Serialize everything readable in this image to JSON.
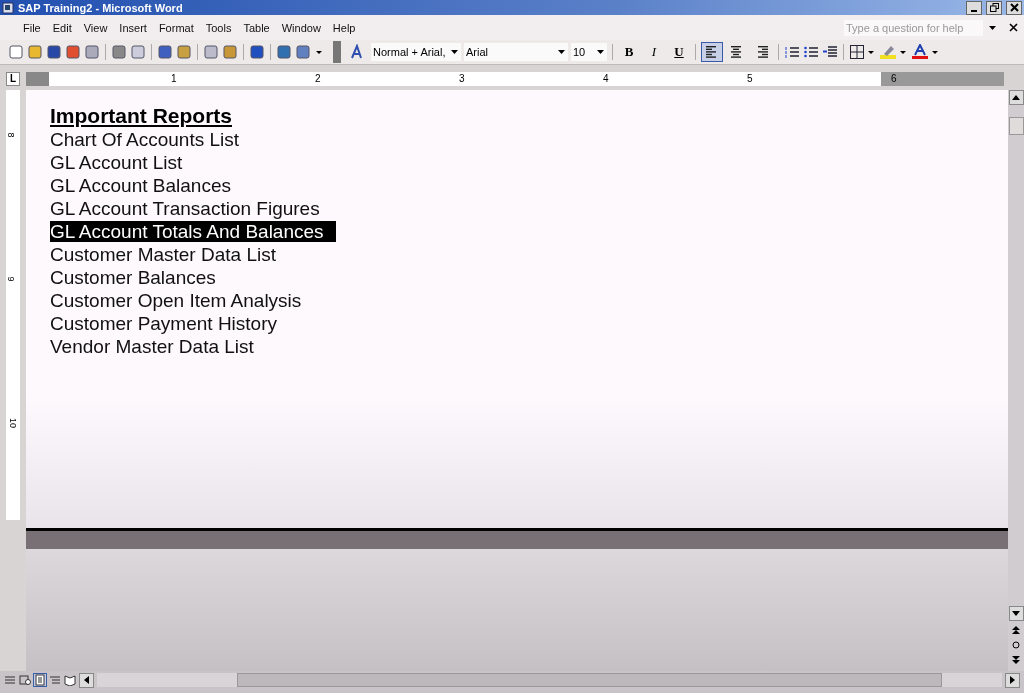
{
  "window": {
    "title": "SAP Training2 - Microsoft Word"
  },
  "menu": [
    "File",
    "Edit",
    "View",
    "Insert",
    "Format",
    "Tools",
    "Table",
    "Window",
    "Help"
  ],
  "help_box": {
    "placeholder": "Type a question for help"
  },
  "formatting": {
    "style": "Normal + Arial,",
    "font": "Arial",
    "size": "10",
    "text_buttons": [
      {
        "label": "B",
        "kind": "bold"
      },
      {
        "label": "I",
        "kind": "italic"
      },
      {
        "label": "U",
        "kind": "underline"
      }
    ],
    "alignment": [
      {
        "kind": "left",
        "selected": true
      },
      {
        "kind": "center",
        "selected": false
      },
      {
        "kind": "right",
        "selected": false
      }
    ]
  },
  "ruler": {
    "tab_selector": "L",
    "labels": [
      "1",
      "2",
      "3",
      "4",
      "5",
      "6"
    ]
  },
  "vertical_ruler": {
    "labels": [
      "8",
      "9",
      "10"
    ]
  },
  "document": {
    "heading": "Important Reports",
    "lines": [
      {
        "text": "Chart Of Accounts List",
        "selected": false
      },
      {
        "text": "GL Account List",
        "selected": false
      },
      {
        "text": "GL Account Balances",
        "selected": false
      },
      {
        "text": "GL Account Transaction Figures",
        "selected": false
      },
      {
        "text": "GL Account Totals And Balances",
        "selected": true
      },
      {
        "text": "Customer Master Data List",
        "selected": false
      },
      {
        "text": "Customer Balances",
        "selected": false
      },
      {
        "text": "Customer Open Item Analysis",
        "selected": false
      },
      {
        "text": "Customer Payment History",
        "selected": false
      },
      {
        "text": "Vendor Master Data List",
        "selected": false
      }
    ]
  }
}
